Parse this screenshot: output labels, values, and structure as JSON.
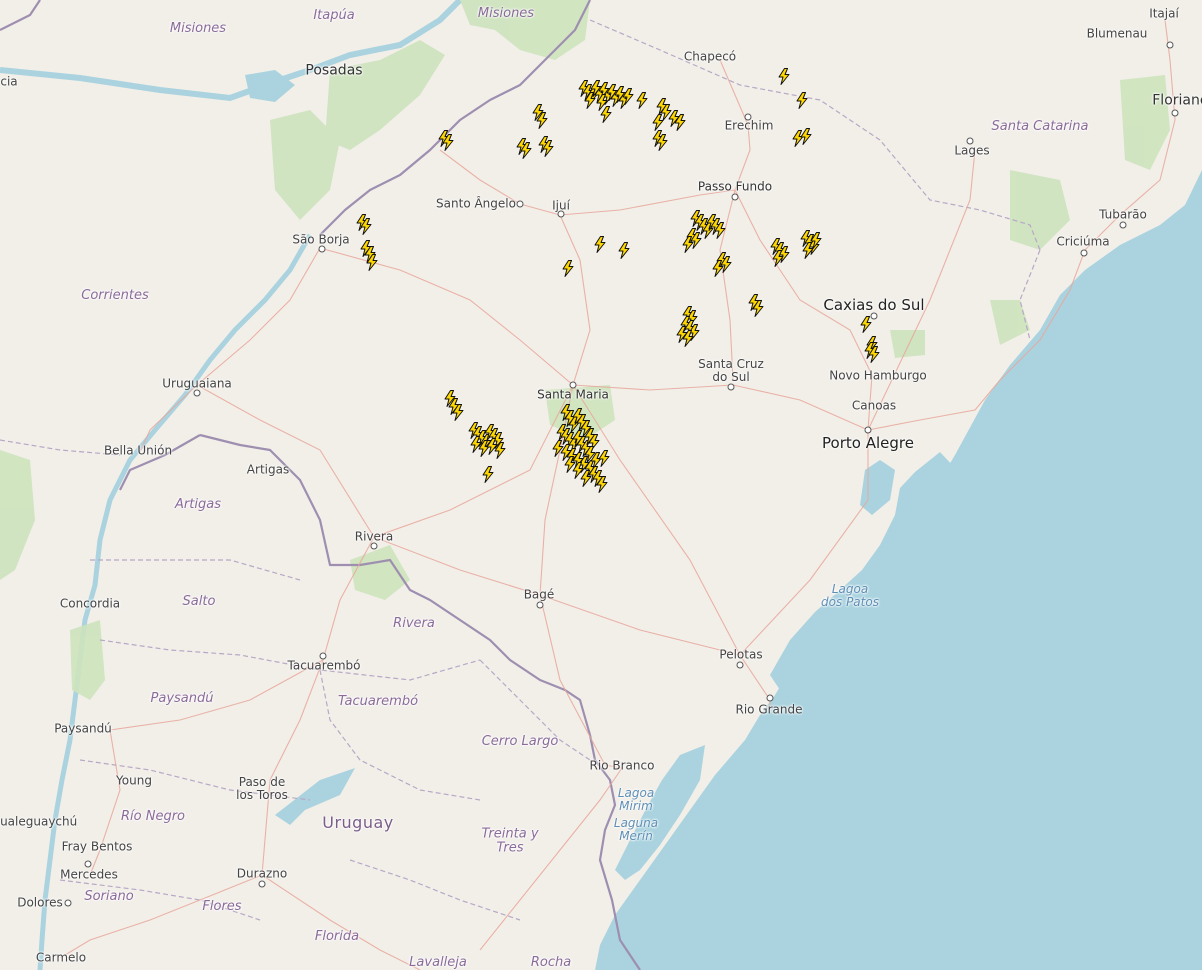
{
  "colors": {
    "land": "#f2efe9",
    "sea": "#aad3df",
    "forest": "#cde3bd",
    "bolt_fill": "#ffd700",
    "bolt_stroke": "#111111",
    "border": "#9e8fb0"
  },
  "icons": {
    "lightning": "lightning-bolt-icon"
  },
  "labels": {
    "itapua": "Itapúa",
    "misiones_top": "Misiones",
    "misiones_left": "Misiones",
    "posadas": "Posadas",
    "chapeco": "Chapecó",
    "itajai": "Itajaí",
    "blumenau": "Blumenau",
    "florianopolis": "Florianópolis",
    "erechim": "Erechim",
    "santa_catarina": "Santa Catarina",
    "lages": "Lages",
    "passo_fundo": "Passo Fundo",
    "santo_angelo": "Santo Ângelo",
    "ijui": "Ijuí",
    "tubarao": "Tubarão",
    "criciuma": "Criciúma",
    "sao_borja": "São Borja",
    "corrientes": "Corrientes",
    "caxias_do_sul": "Caxias do Sul",
    "santa_cruz_1": "Santa Cruz",
    "santa_cruz_2": "do Sul",
    "novo_hamburgo": "Novo Hamburgo",
    "uruguaiana": "Uruguaiana",
    "santa_maria": "Santa Maria",
    "canoas": "Canoas",
    "porto_alegre": "Porto Alegre",
    "bella_union": "Bella Unión",
    "artigas_city": "Artigas",
    "artigas_dept": "Artigas",
    "rivera_city": "Rivera",
    "lagoa_patos_1": "Lagoa",
    "lagoa_patos_2": "dos Patos",
    "concordia": "Concordia",
    "salto": "Salto",
    "bage": "Bagé",
    "rivera_dept": "Rivera",
    "pelotas": "Pelotas",
    "tacuarembo_city": "Tacuarembó",
    "paysandu_dept": "Paysandú",
    "tacuarembo_dept": "Tacuarembó",
    "rio_grande": "Rio Grande",
    "paysandu_city": "Paysandú",
    "cerro_largo": "Cerro Largo",
    "young": "Young",
    "paso_toros_1": "Paso de",
    "paso_toros_2": "los Toros",
    "rio_branco": "Rio Branco",
    "lagoa_mirim_1": "Lagoa",
    "lagoa_mirim_2": "Mirim",
    "laguna_merin_1": "Laguna",
    "laguna_merin_2": "Merín",
    "gualeguaychu": "Gualeguaychú",
    "rio_negro": "Río Negro",
    "uruguay": "Uruguay",
    "treinta_tres_1": "Treinta y",
    "treinta_tres_2": "Tres",
    "fray_bentos": "Fray Bentos",
    "mercedes": "Mercedes",
    "soriano": "Soriano",
    "durazno": "Durazno",
    "dolores": "Dolores",
    "flores": "Flores",
    "florida": "Florida",
    "carmelo": "Carmelo",
    "lavalleja": "Lavalleja",
    "rocha": "Rocha",
    "cia_edge": "cia"
  }
}
